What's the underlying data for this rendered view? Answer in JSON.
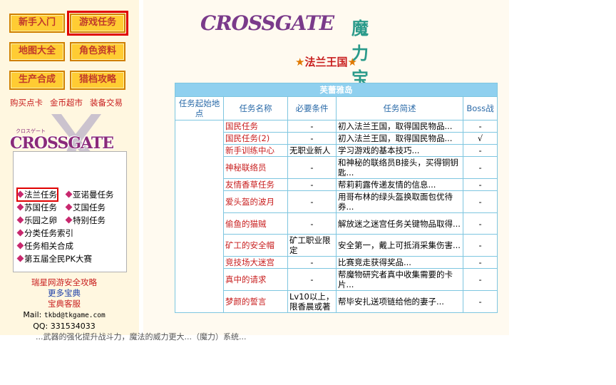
{
  "nav": {
    "buttons": [
      "新手入门",
      "游戏任务",
      "地图大全",
      "角色资料",
      "生产合成",
      "猎档攻略"
    ],
    "active_index": 1
  },
  "quick_links": [
    "购买点卡",
    "金币超市",
    "装备交易"
  ],
  "sidebar_logo": "CROSSGATE",
  "sidebar_logo_small": "クロスゲート",
  "task_menu": [
    "法兰任务",
    "亚诺曼任务",
    "苏国任务",
    "艾国任务",
    "乐园之卵",
    "特别任务",
    "分类任务索引",
    "任务相关合成",
    "第五届全民PK大赛"
  ],
  "footer": {
    "safety": "瑞星网游安全攻略",
    "more": "更多宝典",
    "service": "宝典客服",
    "mail_label": "Mail:",
    "mail": "tkbd@tkgame.com",
    "qq": "QQ: 331534033"
  },
  "banner": {
    "logo": "CROSSGATE",
    "cn": "魔力宝贝"
  },
  "page_title": "★法兰王国★",
  "table": {
    "region": "芙蕾雅岛",
    "headers": [
      "任务起始地点",
      "任务名称",
      "必要条件",
      "任务简述",
      "Boss战"
    ],
    "rows": [
      {
        "name": "国民任务",
        "cond": "-",
        "desc": "初入法兰王国，取得国民物品...",
        "boss": "-"
      },
      {
        "name": "国民任务(2)",
        "cond": "-",
        "desc": "初入法兰王国，取得国民物品...",
        "boss": "√"
      },
      {
        "name": "新手训练中心",
        "cond": "无职业新人",
        "desc": "学习游戏的基本技巧...",
        "boss": "-"
      },
      {
        "name": "神秘联络员",
        "cond": "-",
        "desc": "和神秘的联络员B接头，买得铜钥匙...",
        "boss": "-"
      },
      {
        "name": "友情香草任务",
        "cond": "-",
        "desc": "帮莉莉露传递友情的信息...",
        "boss": "-"
      },
      {
        "name": "爱头盔的波月",
        "cond": "-",
        "desc": "用哥布林的绿头盔换取面包优待券...",
        "boss": "-"
      },
      {
        "name": "偷鱼的猫贼",
        "cond": "-",
        "desc": "解放迷之迷宫任务关键物品取得...",
        "boss": "-"
      },
      {
        "name": "矿工的安全帽",
        "cond": "矿工职业限定",
        "desc": "安全第一，戴上可抵消采集伤害...",
        "boss": "-"
      },
      {
        "name": "竞技场大迷宫",
        "cond": "-",
        "desc": "比赛竞走获得奖品...",
        "boss": "-"
      },
      {
        "name": "真中的请求",
        "cond": "-",
        "desc": "帮魔物研究者真中收集需要的卡片...",
        "boss": "-"
      },
      {
        "name": "梦颜的誓言",
        "cond": "Lv10以上，限香晨或著",
        "desc": "帮毕安扎送项链给他的妻子...",
        "boss": "-"
      }
    ]
  },
  "overflow_text": "...武器的强化提升战斗力，魔法的威力更大...（魔力）系统..."
}
